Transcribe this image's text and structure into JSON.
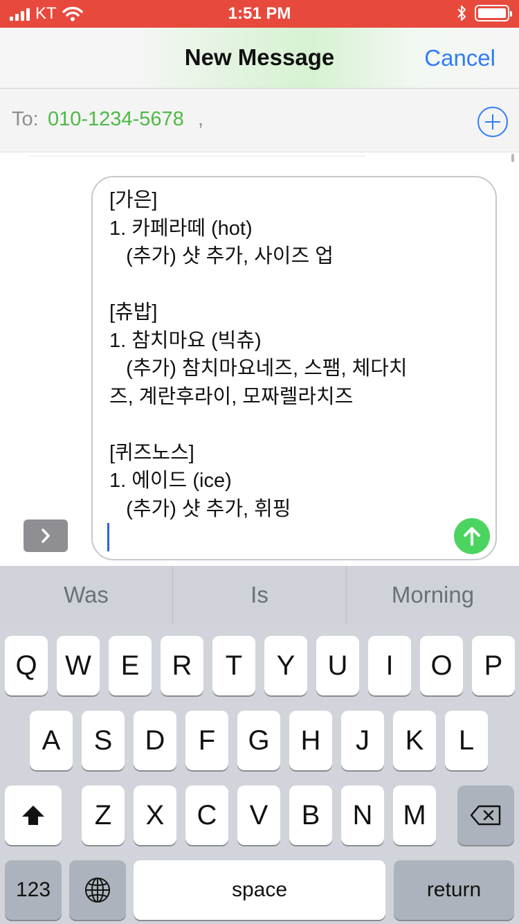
{
  "status_bar": {
    "carrier": "KT",
    "time": "1:51 PM"
  },
  "nav": {
    "title": "New Message",
    "cancel_label": "Cancel"
  },
  "recipient": {
    "to_label": "To:",
    "recipient": "010-1234-5678",
    "separator": ","
  },
  "message": {
    "lines": [
      "[가은]",
      "1. 카페라떼 (hot)",
      "   (추가) 샷 추가, 사이즈 업",
      "",
      "[츄밥]",
      "1. 참치마요 (빅츄)",
      "   (추가) 참치마요네즈, 스팸, 체다치",
      "즈, 계란후라이, 모짜렐라치즈",
      "",
      "[퀴즈노스]",
      "1. 에이드 (ice)",
      "   (추가) 샷 추가, 휘핑"
    ]
  },
  "suggestions": [
    "Was",
    "Is",
    "Morning"
  ],
  "keyboard": {
    "row1": [
      "Q",
      "W",
      "E",
      "R",
      "T",
      "Y",
      "U",
      "I",
      "O",
      "P"
    ],
    "row2": [
      "A",
      "S",
      "D",
      "F",
      "G",
      "H",
      "J",
      "K",
      "L"
    ],
    "row3": [
      "Z",
      "X",
      "C",
      "V",
      "B",
      "N",
      "M"
    ],
    "numbers_label": "123",
    "space_label": "space",
    "return_label": "return"
  },
  "colors": {
    "status_bar": "#e8493d",
    "accent_blue": "#2f7cf6",
    "recipient_green": "#4cb944",
    "send_green": "#4cd461"
  },
  "icons": {
    "wifi": "wifi-icon",
    "bluetooth": "bluetooth-icon",
    "battery": "battery-icon",
    "add": "add-contact-icon",
    "expand": "chevron-right-icon",
    "send": "arrow-up-icon",
    "shift": "shift-icon",
    "delete": "backspace-icon",
    "globe": "globe-icon"
  }
}
